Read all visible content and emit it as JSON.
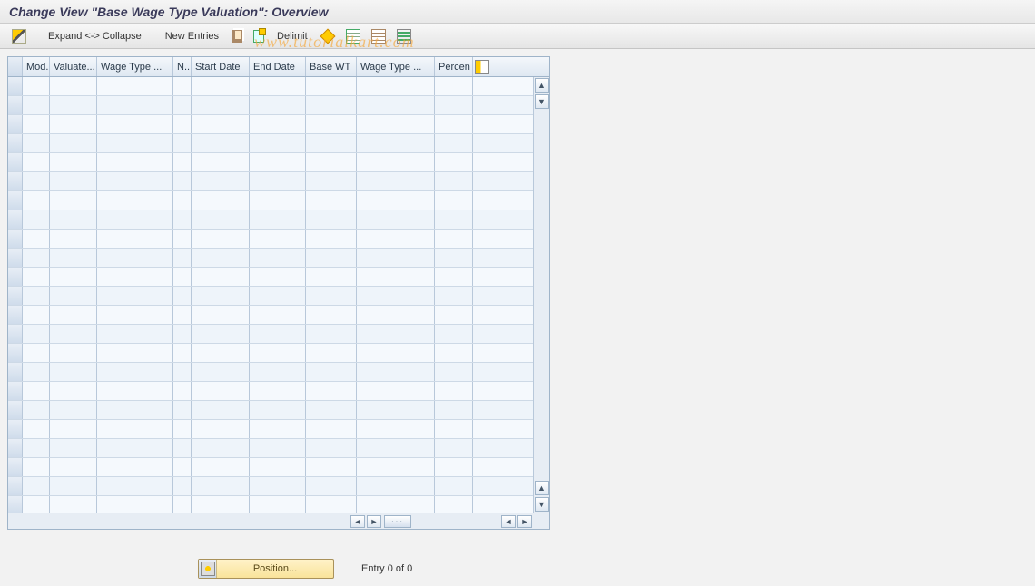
{
  "title": "Change View \"Base Wage Type Valuation\": Overview",
  "watermark": "www.tutorialkart.com",
  "toolbar": {
    "expand_collapse": "Expand <-> Collapse",
    "new_entries": "New Entries",
    "delimit": "Delimit"
  },
  "grid": {
    "columns": [
      "Mod.",
      "Valuate...",
      "Wage Type ...",
      "N..",
      "Start Date",
      "End Date",
      "Base WT",
      "Wage Type ...",
      "Percen"
    ],
    "row_count": 23,
    "rows": []
  },
  "footer": {
    "position_label": "Position...",
    "entry_text": "Entry 0 of 0"
  }
}
